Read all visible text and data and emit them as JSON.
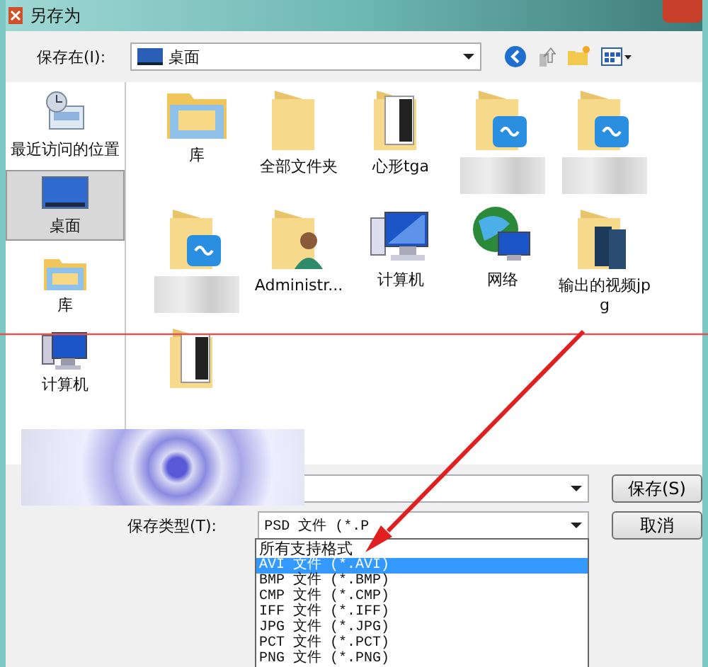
{
  "window": {
    "title": "另存为"
  },
  "save_in": {
    "label": "保存在(I):",
    "value": "桌面"
  },
  "sidebar": {
    "items": [
      {
        "label": "最近访问的位置",
        "kind": "recent",
        "selected": false
      },
      {
        "label": "桌面",
        "kind": "desktop",
        "selected": true
      },
      {
        "label": "库",
        "kind": "library",
        "selected": false
      },
      {
        "label": "计算机",
        "kind": "computer",
        "selected": false
      }
    ]
  },
  "files": [
    {
      "name": "库",
      "kind": "library",
      "blurred": false
    },
    {
      "name": "全部文件夹",
      "kind": "folder",
      "blurred": false
    },
    {
      "name": "心形tga",
      "kind": "folder-doc",
      "blurred": false
    },
    {
      "kind": "sync-folder",
      "blurred": true
    },
    {
      "kind": "sync-folder",
      "blurred": true
    },
    {
      "kind": "sync-folder",
      "blurred": true
    },
    {
      "name": "Administr...",
      "kind": "user-folder",
      "blurred": false
    },
    {
      "name": "计算机",
      "kind": "computer",
      "blurred": false
    },
    {
      "name": "网络",
      "kind": "network",
      "blurred": false
    },
    {
      "name": "输出的视频jpg",
      "kind": "video-folder",
      "blurred": false
    },
    {
      "kind": "folder-doc",
      "blurred": false
    }
  ],
  "file_type": {
    "label": "保存类型(T):",
    "value": "PSD 文件 (*.P",
    "options": [
      {
        "label": "所有支持格式",
        "selected": false
      },
      {
        "label": "AVI 文件 (*.AVI)",
        "selected": true
      },
      {
        "label": "BMP 文件 (*.BMP)",
        "selected": false
      },
      {
        "label": "CMP 文件 (*.CMP)",
        "selected": false
      },
      {
        "label": "IFF 文件 (*.IFF)",
        "selected": false
      },
      {
        "label": "JPG 文件 (*.JPG)",
        "selected": false
      },
      {
        "label": "PCT 文件 (*.PCT)",
        "selected": false
      },
      {
        "label": "PNG 文件 (*.PNG)",
        "selected": false
      }
    ]
  },
  "save_button": "保存(S)",
  "cancel_button": "取消"
}
